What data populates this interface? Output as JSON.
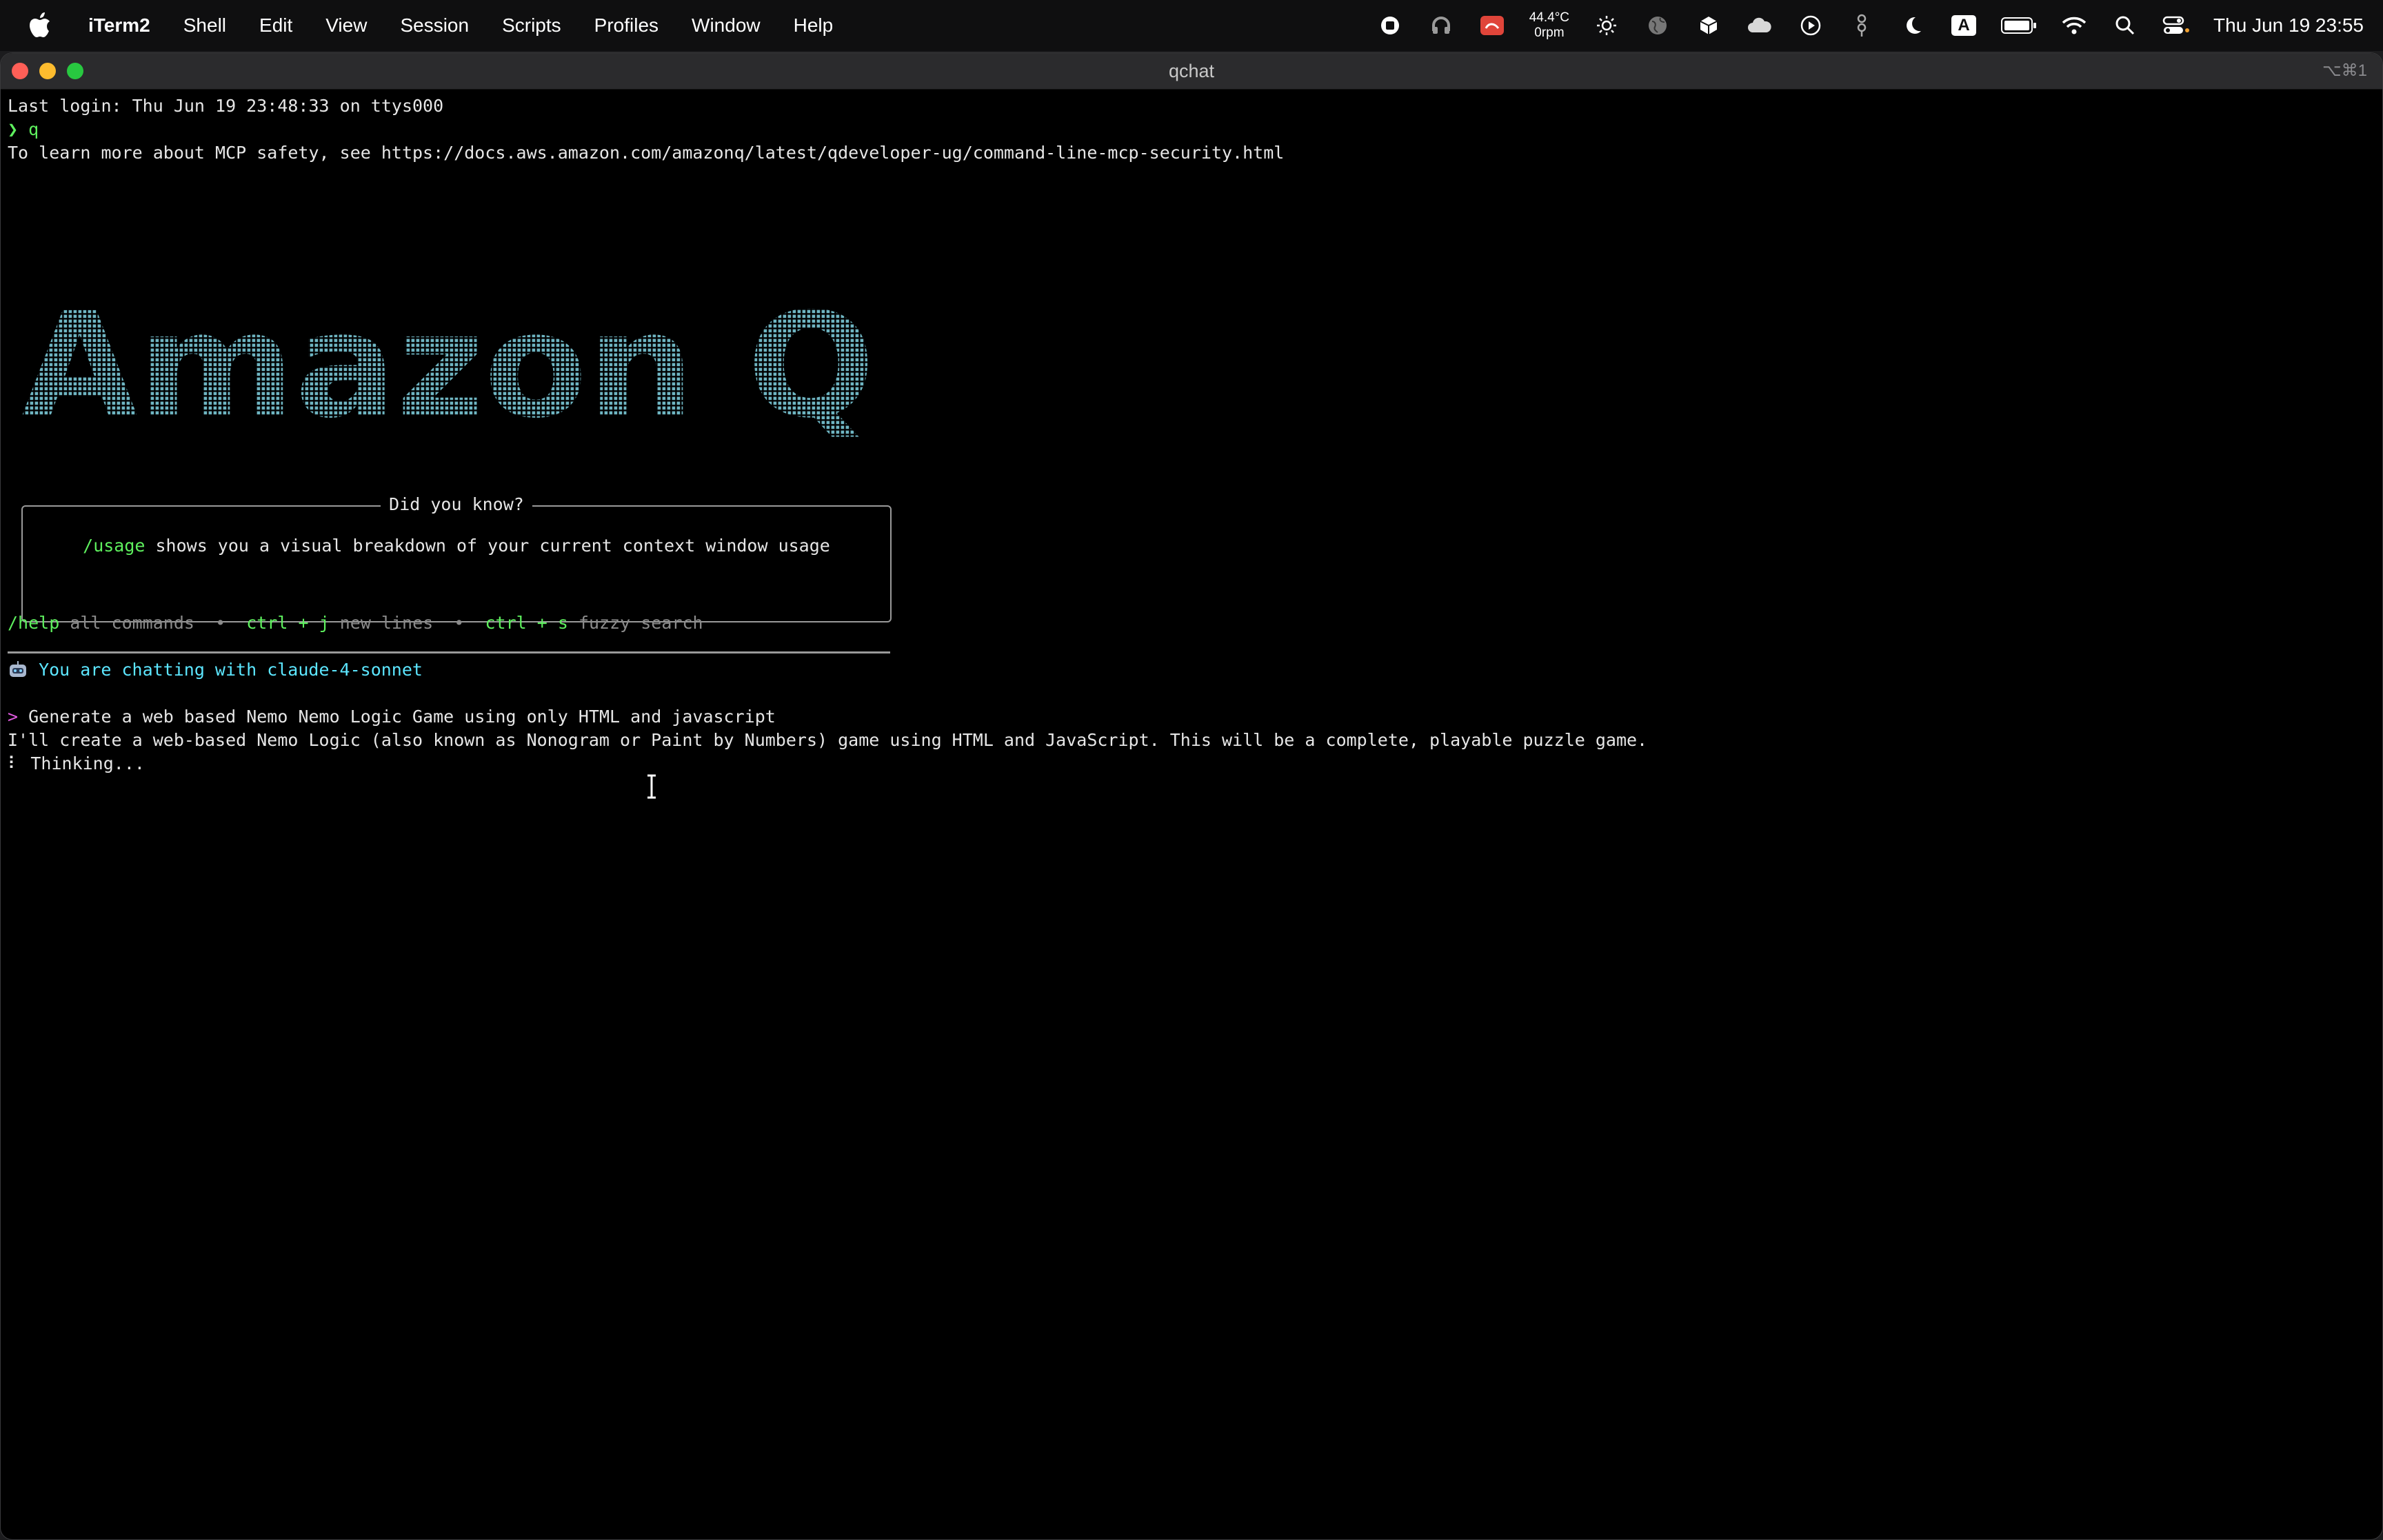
{
  "menubar": {
    "app_name": "iTerm2",
    "menus": [
      "Shell",
      "Edit",
      "View",
      "Session",
      "Scripts",
      "Profiles",
      "Window",
      "Help"
    ],
    "status": {
      "temperature": "44.4°C",
      "fan": "0rpm",
      "input_source": "A",
      "datetime": "Thu Jun 19  23:55"
    }
  },
  "window": {
    "title": "qchat",
    "shortcut": "⌥⌘1"
  },
  "terminal": {
    "last_login": "Last login: Thu Jun 19 23:48:33 on ttys000",
    "prompt_symbol": "❯",
    "command": "q",
    "mcp_notice": "To learn more about MCP safety, see https://docs.aws.amazon.com/amazonq/latest/qdeveloper-ug/command-line-mcp-security.html",
    "logo_text": "Amazon Q",
    "tip": {
      "title": "Did you know?",
      "command": "/usage",
      "text": " shows you a visual breakdown of your current context window usage"
    },
    "help_bar": {
      "cmd1": "/help",
      "desc1": "all commands",
      "sep": "•",
      "cmd2": "ctrl + j",
      "desc2": "new lines",
      "cmd3": "ctrl + s",
      "desc3": "fuzzy search"
    },
    "model_notice": "You are chatting with claude-4-sonnet",
    "user_prompt_symbol": ">",
    "user_message": "Generate a web based Nemo Nemo Logic Game using only HTML and javascript",
    "assistant_message": "I'll create a web-based Nemo Logic (also known as Nonogram or Paint by Numbers) game using HTML and JavaScript. This will be a complete, playable puzzle game.",
    "spinner": "⠇",
    "status_text": "Thinking..."
  }
}
